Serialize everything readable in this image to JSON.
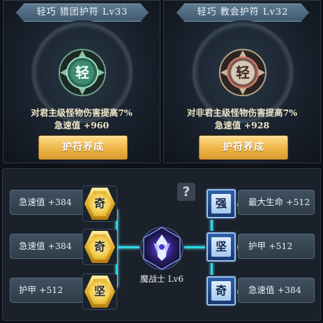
{
  "amulets": [
    {
      "title": "轻巧  猎团护符  Lv33",
      "glyph": "轻",
      "theme": "green",
      "effect": "对君主级怪物伤害提高7%",
      "speed": "急速值  +960",
      "button": "护符养成"
    },
    {
      "title": "轻巧  教会护符  Lv32",
      "glyph": "轻",
      "theme": "red",
      "effect": "对非君主级怪物伤害提高7%",
      "speed": "急速值  +928",
      "button": "护符养成"
    }
  ],
  "help": "?",
  "talents": {
    "left_slots": [
      "急速值 +384",
      "急速值 +384",
      "护甲   +512"
    ],
    "left_nodes": [
      "奇",
      "奇",
      "坚"
    ],
    "right_nodes": [
      "强",
      "坚",
      "奇"
    ],
    "right_slots": [
      "最大生命  +512",
      "护甲   +512",
      "急速值 +384"
    ],
    "center_label": "魔战士 Lv6"
  },
  "colors": {
    "gold_node": "#e4b32e",
    "blue_node": "#2e5fa8",
    "link": "#2fd9e8",
    "button": "#f0b84c"
  }
}
